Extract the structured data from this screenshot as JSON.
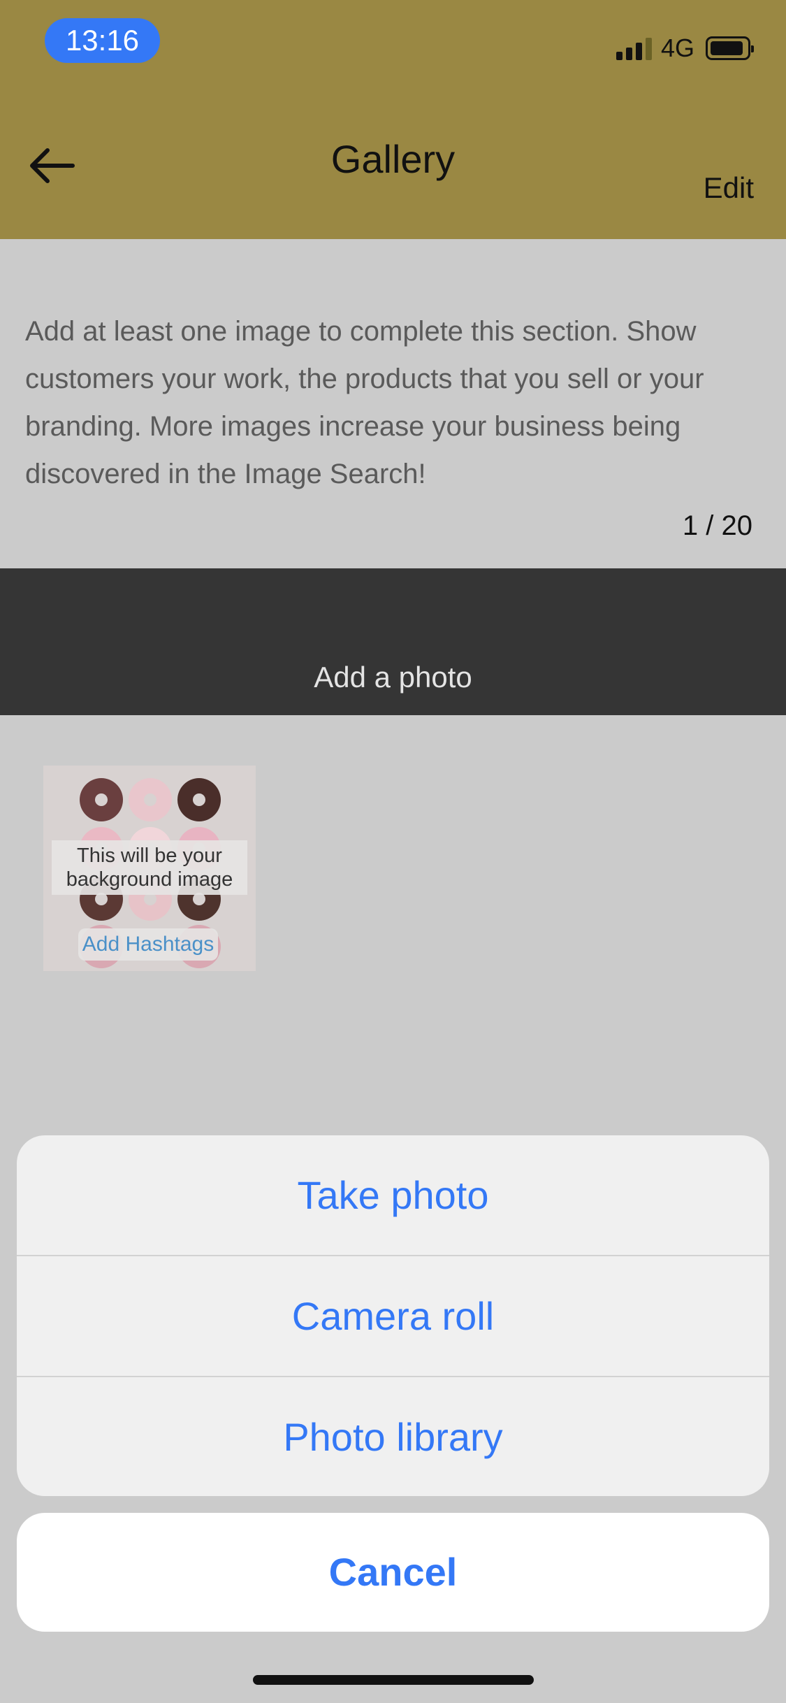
{
  "status_bar": {
    "time": "13:16",
    "network": "4G"
  },
  "nav": {
    "title": "Gallery",
    "edit_label": "Edit"
  },
  "description": "Add at least one image to complete this section. Show customers your work, the products that you sell or your branding. More images increase your business being discovered in the Image Search!",
  "counter": "1 / 20",
  "add_photo": {
    "label": "Add a photo",
    "icon": "camera-add-icon"
  },
  "gallery": {
    "images": [
      {
        "note": "This will be your background image",
        "hashtag_label": "Add Hashtags"
      }
    ]
  },
  "action_sheet": {
    "options": [
      "Take photo",
      "Camera roll",
      "Photo library"
    ],
    "cancel_label": "Cancel"
  },
  "colors": {
    "accent": "#3478f6",
    "header": "#9a8843",
    "addbar": "#353535"
  }
}
